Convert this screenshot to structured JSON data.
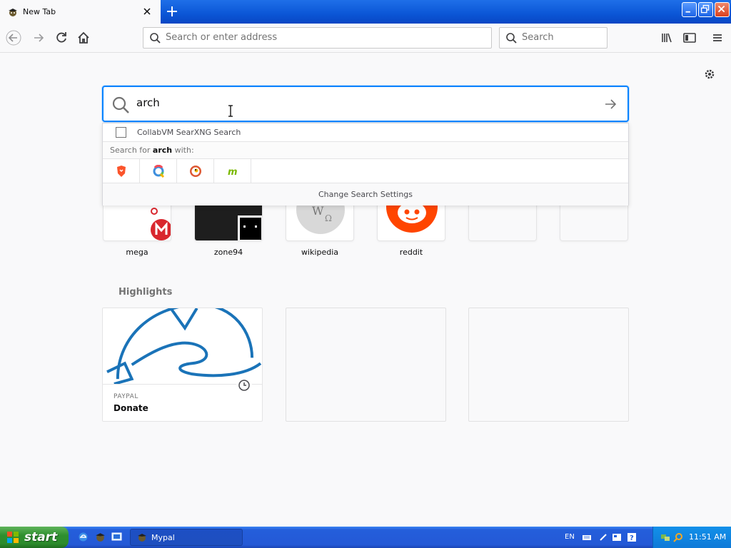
{
  "browser": {
    "tab": {
      "title": "New Tab",
      "favicon": "pirate-fox-icon"
    },
    "urlbar": {
      "placeholder": "Search or enter address",
      "value": ""
    },
    "searchbar": {
      "placeholder": "Search",
      "value": ""
    }
  },
  "newtab": {
    "search": {
      "value": "arch"
    },
    "dropdown": {
      "suggestion": "CollabVM SearXNG Search",
      "search_for_prefix": "Search for ",
      "search_term": "arch",
      "search_for_suffix": " with:",
      "engines": [
        "brave-icon",
        "qwant-icon",
        "duckduckgo-icon",
        "mojeek-icon"
      ],
      "settings_label": "Change Search Settings"
    },
    "top_sites": [
      {
        "label": "mega"
      },
      {
        "label": "zone94"
      },
      {
        "label": "wikipedia"
      },
      {
        "label": "reddit"
      },
      {
        "label": ""
      },
      {
        "label": ""
      }
    ],
    "highlights": {
      "title": "Highlights",
      "cards": [
        {
          "host": "PAYPAL",
          "title": "Donate"
        }
      ]
    }
  },
  "taskbar": {
    "start_label": "start",
    "task_label": "Mypal",
    "language": "EN",
    "clock": "11:51 AM"
  },
  "colors": {
    "accent": "#0a84ff",
    "xp_taskbar": "#245edb",
    "xp_start": "#2f8f2f",
    "reddit": "#ff4500",
    "mega": "#d9272e",
    "paypal_art": "#1a73b8"
  }
}
